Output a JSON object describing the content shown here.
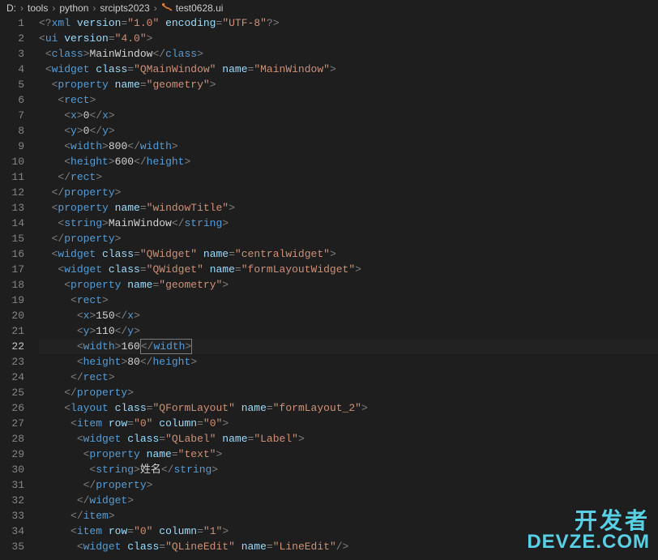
{
  "breadcrumb": {
    "items": [
      "D:",
      "tools",
      "python",
      "srcipts2023",
      "test0628.ui"
    ]
  },
  "gutter": {
    "start": 1,
    "end": 35,
    "active": 22
  },
  "code": {
    "lines": [
      {
        "indent": 0,
        "type": "xmldecl",
        "tok": [
          [
            "br",
            "<?"
          ],
          [
            "tag",
            "xml "
          ],
          [
            "attr",
            "version"
          ],
          [
            "br",
            "="
          ],
          [
            "str",
            "\"1.0\""
          ],
          [
            "txt",
            " "
          ],
          [
            "attr",
            "encoding"
          ],
          [
            "br",
            "="
          ],
          [
            "str",
            "\"UTF-8\""
          ],
          [
            "br",
            "?>"
          ]
        ]
      },
      {
        "indent": 0,
        "type": "open",
        "tok": [
          [
            "br",
            "<"
          ],
          [
            "tag",
            "ui "
          ],
          [
            "attr",
            "version"
          ],
          [
            "br",
            "="
          ],
          [
            "str",
            "\"4.0\""
          ],
          [
            "br",
            ">"
          ]
        ]
      },
      {
        "indent": 1,
        "type": "inline",
        "tok": [
          [
            "br",
            "<"
          ],
          [
            "tag",
            "class"
          ],
          [
            "br",
            ">"
          ],
          [
            "txt",
            "MainWindow"
          ],
          [
            "br",
            "</"
          ],
          [
            "tag",
            "class"
          ],
          [
            "br",
            ">"
          ]
        ]
      },
      {
        "indent": 1,
        "type": "open",
        "tok": [
          [
            "br",
            "<"
          ],
          [
            "tag",
            "widget "
          ],
          [
            "attr",
            "class"
          ],
          [
            "br",
            "="
          ],
          [
            "str",
            "\"QMainWindow\""
          ],
          [
            "txt",
            " "
          ],
          [
            "attr",
            "name"
          ],
          [
            "br",
            "="
          ],
          [
            "str",
            "\"MainWindow\""
          ],
          [
            "br",
            ">"
          ]
        ]
      },
      {
        "indent": 2,
        "type": "open",
        "tok": [
          [
            "br",
            "<"
          ],
          [
            "tag",
            "property "
          ],
          [
            "attr",
            "name"
          ],
          [
            "br",
            "="
          ],
          [
            "str",
            "\"geometry\""
          ],
          [
            "br",
            ">"
          ]
        ]
      },
      {
        "indent": 3,
        "type": "open",
        "tok": [
          [
            "br",
            "<"
          ],
          [
            "tag",
            "rect"
          ],
          [
            "br",
            ">"
          ]
        ]
      },
      {
        "indent": 4,
        "type": "inline",
        "tok": [
          [
            "br",
            "<"
          ],
          [
            "tag",
            "x"
          ],
          [
            "br",
            ">"
          ],
          [
            "txt",
            "0"
          ],
          [
            "br",
            "</"
          ],
          [
            "tag",
            "x"
          ],
          [
            "br",
            ">"
          ]
        ]
      },
      {
        "indent": 4,
        "type": "inline",
        "tok": [
          [
            "br",
            "<"
          ],
          [
            "tag",
            "y"
          ],
          [
            "br",
            ">"
          ],
          [
            "txt",
            "0"
          ],
          [
            "br",
            "</"
          ],
          [
            "tag",
            "y"
          ],
          [
            "br",
            ">"
          ]
        ]
      },
      {
        "indent": 4,
        "type": "inline",
        "tok": [
          [
            "br",
            "<"
          ],
          [
            "tag",
            "width"
          ],
          [
            "br",
            ">"
          ],
          [
            "txt",
            "800"
          ],
          [
            "br",
            "</"
          ],
          [
            "tag",
            "width"
          ],
          [
            "br",
            ">"
          ]
        ]
      },
      {
        "indent": 4,
        "type": "inline",
        "tok": [
          [
            "br",
            "<"
          ],
          [
            "tag",
            "height"
          ],
          [
            "br",
            ">"
          ],
          [
            "txt",
            "600"
          ],
          [
            "br",
            "</"
          ],
          [
            "tag",
            "height"
          ],
          [
            "br",
            ">"
          ]
        ]
      },
      {
        "indent": 3,
        "type": "close",
        "tok": [
          [
            "br",
            "</"
          ],
          [
            "tag",
            "rect"
          ],
          [
            "br",
            ">"
          ]
        ]
      },
      {
        "indent": 2,
        "type": "close",
        "tok": [
          [
            "br",
            "</"
          ],
          [
            "tag",
            "property"
          ],
          [
            "br",
            ">"
          ]
        ]
      },
      {
        "indent": 2,
        "type": "open",
        "tok": [
          [
            "br",
            "<"
          ],
          [
            "tag",
            "property "
          ],
          [
            "attr",
            "name"
          ],
          [
            "br",
            "="
          ],
          [
            "str",
            "\"windowTitle\""
          ],
          [
            "br",
            ">"
          ]
        ]
      },
      {
        "indent": 3,
        "type": "inline",
        "tok": [
          [
            "br",
            "<"
          ],
          [
            "tag",
            "string"
          ],
          [
            "br",
            ">"
          ],
          [
            "txt",
            "MainWindow"
          ],
          [
            "br",
            "</"
          ],
          [
            "tag",
            "string"
          ],
          [
            "br",
            ">"
          ]
        ]
      },
      {
        "indent": 2,
        "type": "close",
        "tok": [
          [
            "br",
            "</"
          ],
          [
            "tag",
            "property"
          ],
          [
            "br",
            ">"
          ]
        ]
      },
      {
        "indent": 2,
        "type": "open",
        "tok": [
          [
            "br",
            "<"
          ],
          [
            "tag",
            "widget "
          ],
          [
            "attr",
            "class"
          ],
          [
            "br",
            "="
          ],
          [
            "str",
            "\"QWidget\""
          ],
          [
            "txt",
            " "
          ],
          [
            "attr",
            "name"
          ],
          [
            "br",
            "="
          ],
          [
            "str",
            "\"centralwidget\""
          ],
          [
            "br",
            ">"
          ]
        ]
      },
      {
        "indent": 3,
        "type": "open",
        "tok": [
          [
            "br",
            "<"
          ],
          [
            "tag",
            "widget "
          ],
          [
            "attr",
            "class"
          ],
          [
            "br",
            "="
          ],
          [
            "str",
            "\"QWidget\""
          ],
          [
            "txt",
            " "
          ],
          [
            "attr",
            "name"
          ],
          [
            "br",
            "="
          ],
          [
            "str",
            "\"formLayoutWidget\""
          ],
          [
            "br",
            ">"
          ]
        ]
      },
      {
        "indent": 4,
        "type": "open",
        "tok": [
          [
            "br",
            "<"
          ],
          [
            "tag",
            "property "
          ],
          [
            "attr",
            "name"
          ],
          [
            "br",
            "="
          ],
          [
            "str",
            "\"geometry\""
          ],
          [
            "br",
            ">"
          ]
        ]
      },
      {
        "indent": 5,
        "type": "open",
        "tok": [
          [
            "br",
            "<"
          ],
          [
            "tag",
            "rect"
          ],
          [
            "br",
            ">"
          ]
        ]
      },
      {
        "indent": 6,
        "type": "inline",
        "tok": [
          [
            "br",
            "<"
          ],
          [
            "tag",
            "x"
          ],
          [
            "br",
            ">"
          ],
          [
            "txt",
            "150"
          ],
          [
            "br",
            "</"
          ],
          [
            "tag",
            "x"
          ],
          [
            "br",
            ">"
          ]
        ]
      },
      {
        "indent": 6,
        "type": "inline",
        "tok": [
          [
            "br",
            "<"
          ],
          [
            "tag",
            "y"
          ],
          [
            "br",
            ">"
          ],
          [
            "txt",
            "110"
          ],
          [
            "br",
            "</"
          ],
          [
            "tag",
            "y"
          ],
          [
            "br",
            ">"
          ]
        ]
      },
      {
        "indent": 6,
        "type": "inline",
        "active": true,
        "tok": [
          [
            "br",
            "<"
          ],
          [
            "tag",
            "width"
          ],
          [
            "br",
            ">"
          ],
          [
            "txt",
            "160"
          ],
          [
            "boxed",
            "</width>"
          ]
        ]
      },
      {
        "indent": 6,
        "type": "inline",
        "tok": [
          [
            "br",
            "<"
          ],
          [
            "tag",
            "height"
          ],
          [
            "br",
            ">"
          ],
          [
            "txt",
            "80"
          ],
          [
            "br",
            "</"
          ],
          [
            "tag",
            "height"
          ],
          [
            "br",
            ">"
          ]
        ]
      },
      {
        "indent": 5,
        "type": "close",
        "tok": [
          [
            "br",
            "</"
          ],
          [
            "tag",
            "rect"
          ],
          [
            "br",
            ">"
          ]
        ]
      },
      {
        "indent": 4,
        "type": "close",
        "tok": [
          [
            "br",
            "</"
          ],
          [
            "tag",
            "property"
          ],
          [
            "br",
            ">"
          ]
        ]
      },
      {
        "indent": 4,
        "type": "open",
        "tok": [
          [
            "br",
            "<"
          ],
          [
            "tag",
            "layout "
          ],
          [
            "attr",
            "class"
          ],
          [
            "br",
            "="
          ],
          [
            "str",
            "\"QFormLayout\""
          ],
          [
            "txt",
            " "
          ],
          [
            "attr",
            "name"
          ],
          [
            "br",
            "="
          ],
          [
            "str",
            "\"formLayout_2\""
          ],
          [
            "br",
            ">"
          ]
        ]
      },
      {
        "indent": 5,
        "type": "open",
        "tok": [
          [
            "br",
            "<"
          ],
          [
            "tag",
            "item "
          ],
          [
            "attr",
            "row"
          ],
          [
            "br",
            "="
          ],
          [
            "str",
            "\"0\""
          ],
          [
            "txt",
            " "
          ],
          [
            "attr",
            "column"
          ],
          [
            "br",
            "="
          ],
          [
            "str",
            "\"0\""
          ],
          [
            "br",
            ">"
          ]
        ]
      },
      {
        "indent": 6,
        "type": "open",
        "tok": [
          [
            "br",
            "<"
          ],
          [
            "tag",
            "widget "
          ],
          [
            "attr",
            "class"
          ],
          [
            "br",
            "="
          ],
          [
            "str",
            "\"QLabel\""
          ],
          [
            "txt",
            " "
          ],
          [
            "attr",
            "name"
          ],
          [
            "br",
            "="
          ],
          [
            "str",
            "\"Label\""
          ],
          [
            "br",
            ">"
          ]
        ]
      },
      {
        "indent": 7,
        "type": "open",
        "tok": [
          [
            "br",
            "<"
          ],
          [
            "tag",
            "property "
          ],
          [
            "attr",
            "name"
          ],
          [
            "br",
            "="
          ],
          [
            "str",
            "\"text\""
          ],
          [
            "br",
            ">"
          ]
        ]
      },
      {
        "indent": 8,
        "type": "inline",
        "tok": [
          [
            "br",
            "<"
          ],
          [
            "tag",
            "string"
          ],
          [
            "br",
            ">"
          ],
          [
            "txt",
            "姓名"
          ],
          [
            "br",
            "</"
          ],
          [
            "tag",
            "string"
          ],
          [
            "br",
            ">"
          ]
        ]
      },
      {
        "indent": 7,
        "type": "close",
        "tok": [
          [
            "br",
            "</"
          ],
          [
            "tag",
            "property"
          ],
          [
            "br",
            ">"
          ]
        ]
      },
      {
        "indent": 6,
        "type": "close",
        "tok": [
          [
            "br",
            "</"
          ],
          [
            "tag",
            "widget"
          ],
          [
            "br",
            ">"
          ]
        ]
      },
      {
        "indent": 5,
        "type": "close",
        "tok": [
          [
            "br",
            "</"
          ],
          [
            "tag",
            "item"
          ],
          [
            "br",
            ">"
          ]
        ]
      },
      {
        "indent": 5,
        "type": "open",
        "tok": [
          [
            "br",
            "<"
          ],
          [
            "tag",
            "item "
          ],
          [
            "attr",
            "row"
          ],
          [
            "br",
            "="
          ],
          [
            "str",
            "\"0\""
          ],
          [
            "txt",
            " "
          ],
          [
            "attr",
            "column"
          ],
          [
            "br",
            "="
          ],
          [
            "str",
            "\"1\""
          ],
          [
            "br",
            ">"
          ]
        ]
      },
      {
        "indent": 6,
        "type": "self",
        "tok": [
          [
            "br",
            "<"
          ],
          [
            "tag",
            "widget "
          ],
          [
            "attr",
            "class"
          ],
          [
            "br",
            "="
          ],
          [
            "str",
            "\"QLineEdit\""
          ],
          [
            "txt",
            " "
          ],
          [
            "attr",
            "name"
          ],
          [
            "br",
            "="
          ],
          [
            "str",
            "\"LineEdit\""
          ],
          [
            "br",
            "/>"
          ]
        ]
      }
    ]
  },
  "watermark": {
    "line1": "开发者",
    "line2": "DEVZE.COM"
  }
}
